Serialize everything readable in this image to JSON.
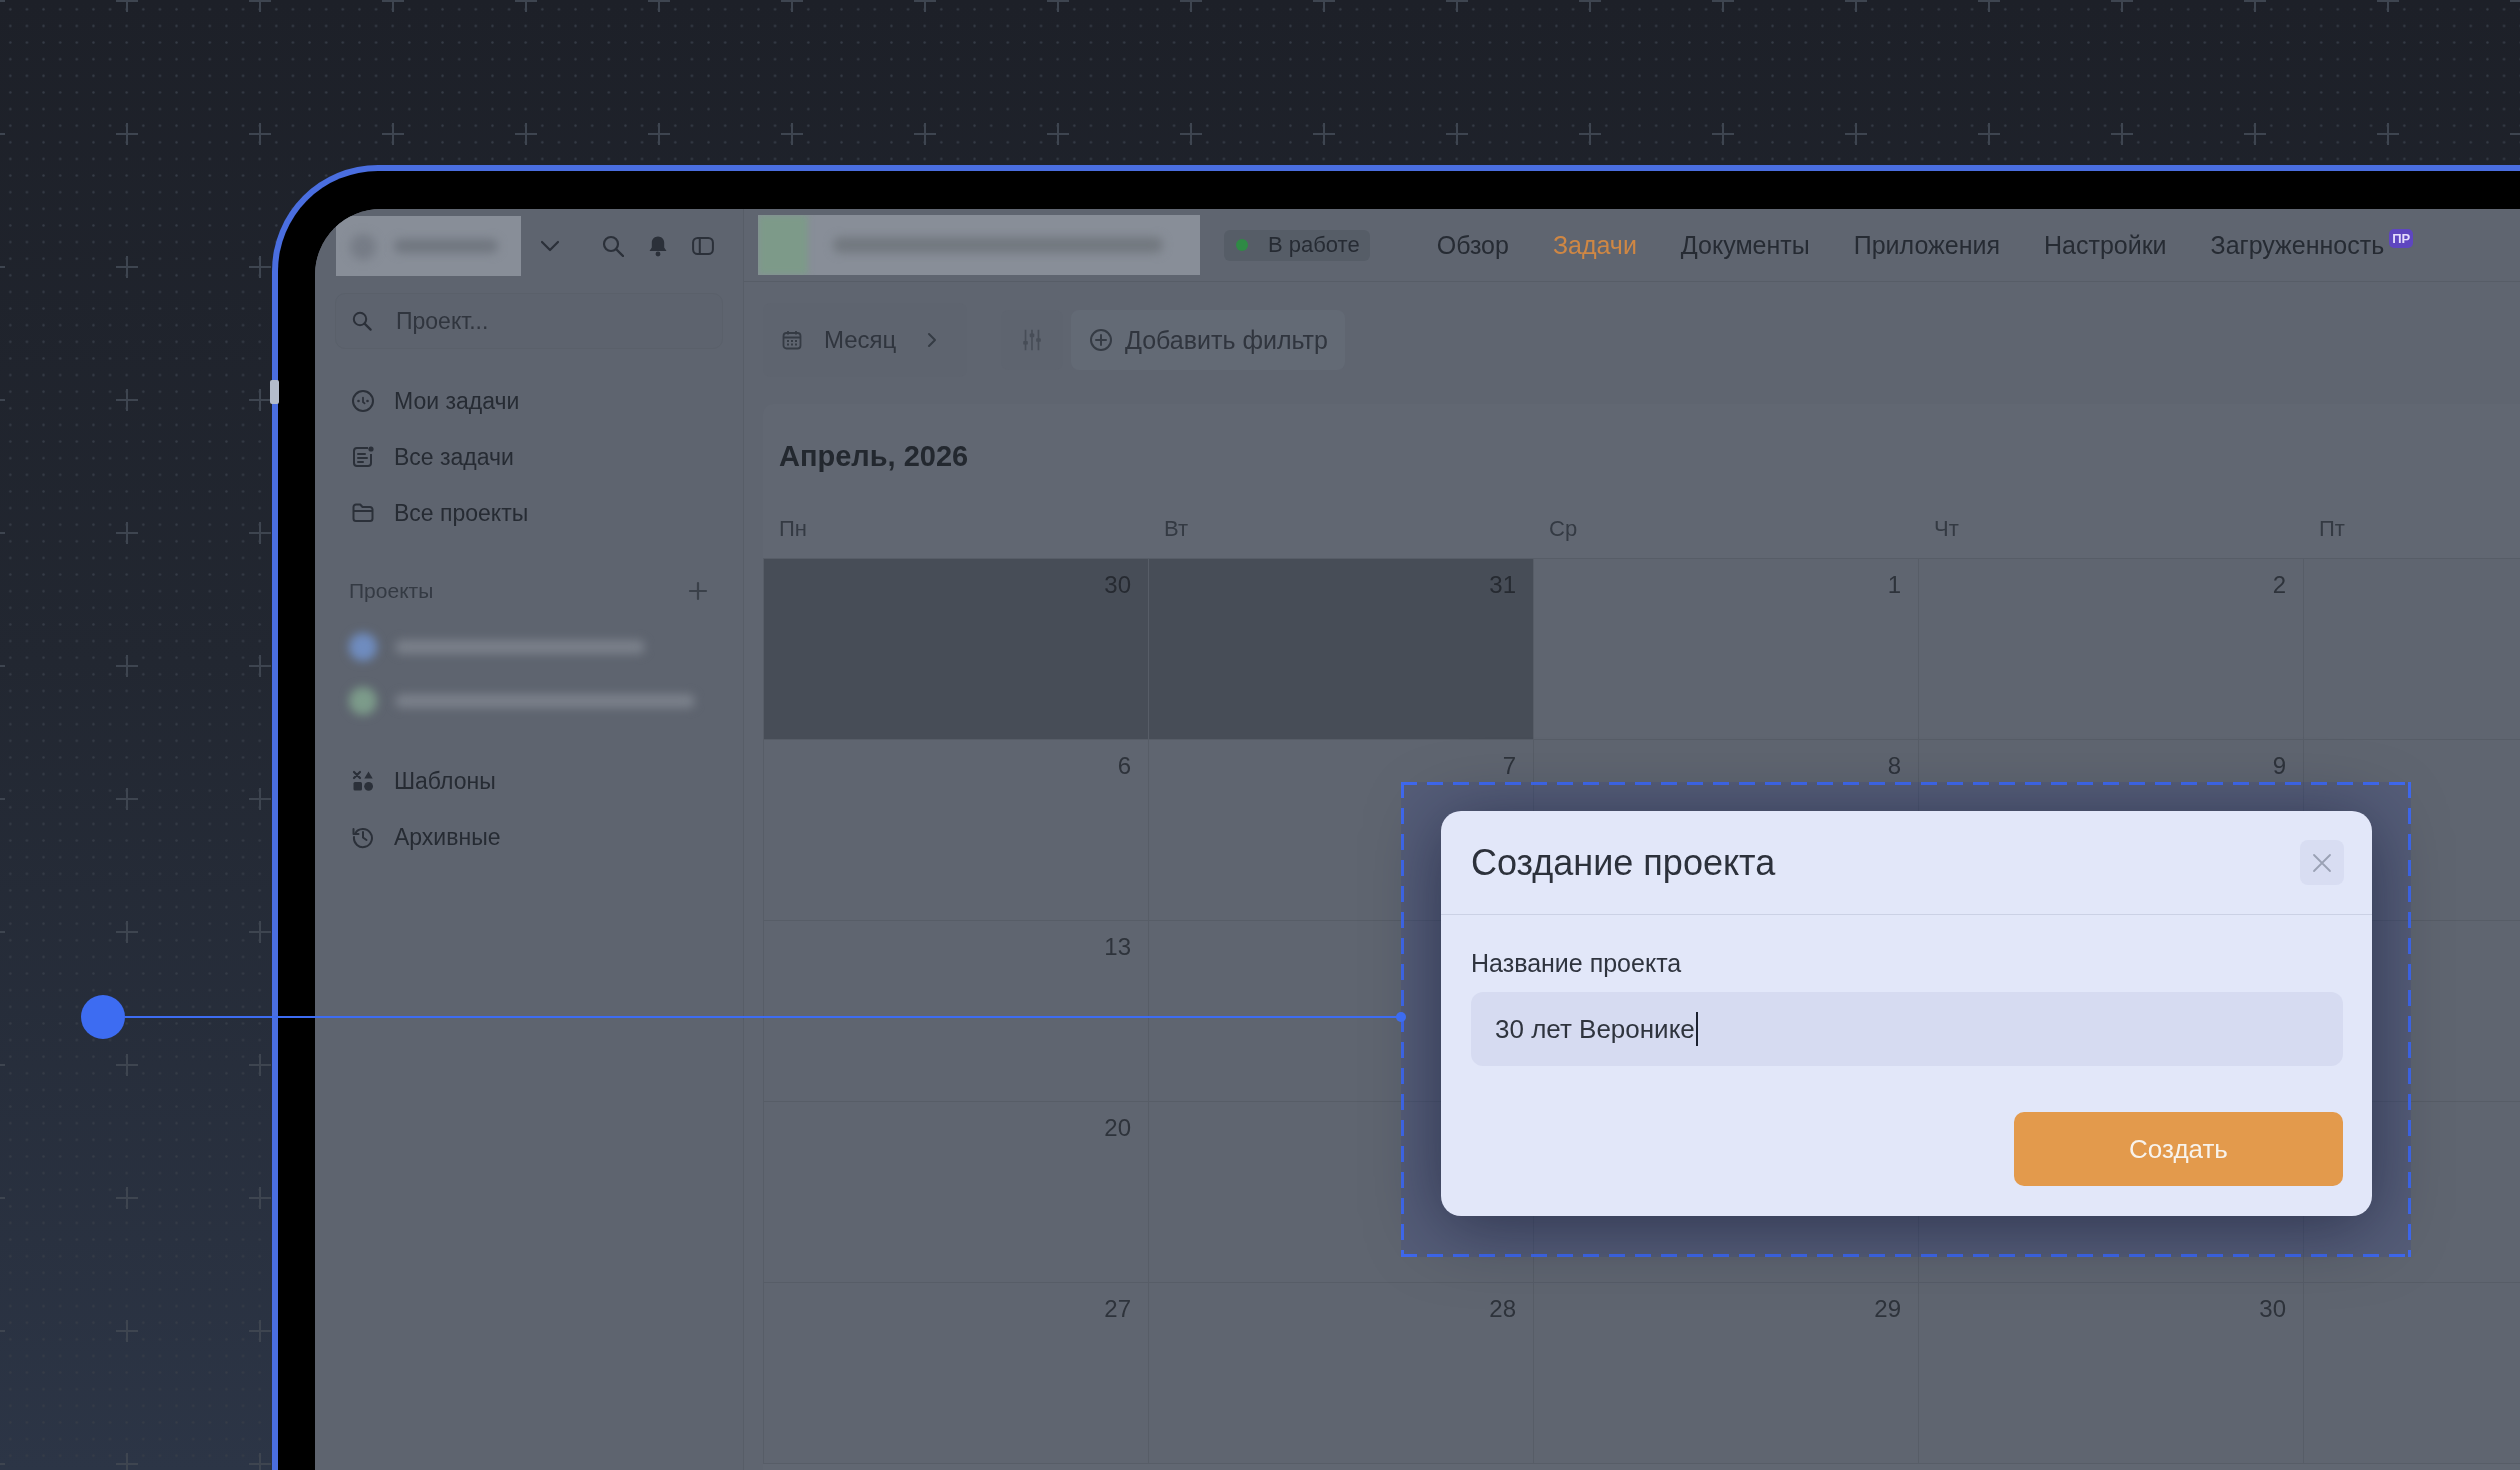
{
  "sidebar": {
    "search": {
      "placeholder": "Проект..."
    },
    "nav_items": [
      {
        "label": "Мои задачи",
        "selected": false
      },
      {
        "label": "Все задачи",
        "selected": false
      },
      {
        "label": "Все проекты",
        "selected": false
      }
    ],
    "projects_section": {
      "title": "Проекты"
    },
    "footer_items": [
      {
        "label": "Шаблоны",
        "selected": false
      },
      {
        "label": "Архивные",
        "selected": false
      }
    ]
  },
  "header": {
    "status": {
      "label": "В работе"
    },
    "tabs": [
      {
        "label": "Обзор",
        "selected": false
      },
      {
        "label": "Задачи",
        "selected": true
      },
      {
        "label": "Документы",
        "selected": false
      },
      {
        "label": "Приложения",
        "selected": false
      },
      {
        "label": "Настройки",
        "selected": false
      },
      {
        "label": "Загруженность",
        "selected": false,
        "badge": "ПР"
      }
    ]
  },
  "toolbar": {
    "view": "Месяц",
    "add_filter": "Добавить фильтр"
  },
  "calendar": {
    "title": "Апрель, 2026",
    "weekdays": [
      "Пн",
      "Вт",
      "Ср",
      "Чт",
      "Пт"
    ],
    "weeks": [
      [
        {
          "day": "30",
          "outside_month": true
        },
        {
          "day": "31",
          "outside_month": true
        },
        {
          "day": "1",
          "outside_month": false
        },
        {
          "day": "2",
          "outside_month": false
        }
      ],
      [
        {
          "day": "6",
          "outside_month": false
        },
        {
          "day": "7",
          "outside_month": false
        },
        {
          "day": "8",
          "outside_month": false
        },
        {
          "day": "9",
          "outside_month": false
        }
      ],
      [
        {
          "day": "13",
          "outside_month": false
        }
      ],
      [
        {
          "day": "20",
          "outside_month": false
        }
      ],
      [
        {
          "day": "27",
          "outside_month": false
        },
        {
          "day": "28",
          "outside_month": false
        },
        {
          "day": "29",
          "outside_month": false
        },
        {
          "day": "30",
          "outside_month": false
        }
      ]
    ]
  },
  "dialog": {
    "title": "Создание проекта",
    "field": {
      "label": "Название проекта",
      "value": "30 лет Веронике"
    },
    "submit": "Создать"
  }
}
